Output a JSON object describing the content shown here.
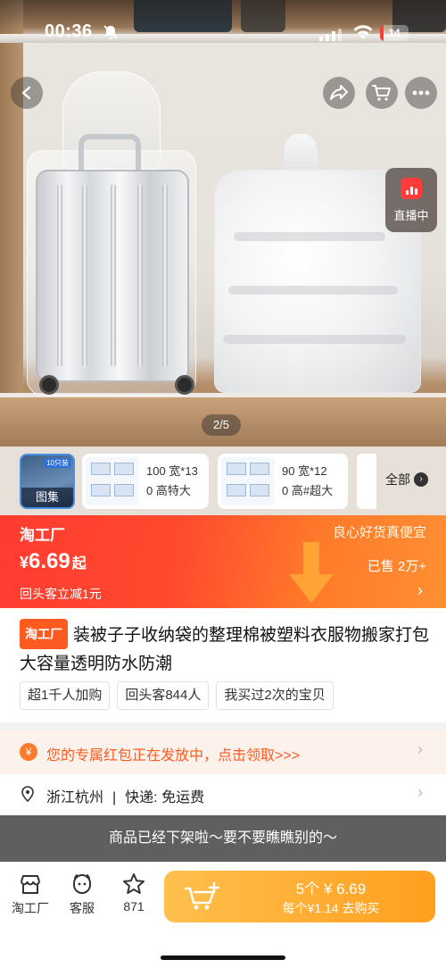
{
  "status_bar": {
    "time": "00:36",
    "battery": "14",
    "battery_level": 0.14
  },
  "nav": {
    "back_icon": "chevron-left-icon",
    "share_icon": "share-icon",
    "cart_icon": "cart-icon",
    "more_icon": "more-icon"
  },
  "live": {
    "label": "直播中"
  },
  "gallery": {
    "counter": "2/5"
  },
  "thumbnails": {
    "gallery_label": "图集",
    "gallery_tag": "10只装",
    "variants": [
      {
        "line1": "100 宽*13",
        "line2": "0 高特大"
      },
      {
        "line1": "90 宽*12",
        "line2": "0 高#超大"
      }
    ],
    "all_label": "全部"
  },
  "price_banner": {
    "brand": "淘工厂",
    "slogan": "良心好货真便宜",
    "price_symbol": "¥",
    "price": "6.69",
    "price_suffix": "起",
    "sold": "已售 2万+",
    "coupon": "回头客立减1元"
  },
  "product": {
    "badge": "淘工厂",
    "title": "装被子子收纳袋的整理棉被塑料衣服物搬家打包大容量透明防水防潮",
    "tags": [
      "超1千人加购",
      "回头客844人",
      "我买过2次的宝贝"
    ]
  },
  "redpack": {
    "text": "您的专属红包正在发放中，点击领取>>>"
  },
  "shipping": {
    "location": "浙江杭州",
    "delivery": "快递: 免运费"
  },
  "delisted": {
    "text": "商品已经下架啦～要不要瞧瞧别的～"
  },
  "bottom_bar": {
    "shop_label": "淘工厂",
    "service_label": "客服",
    "fav_count": "871",
    "buy_line1": "5个 ¥ 6.69",
    "buy_line2": "每个¥1.14  去购买"
  },
  "colors": {
    "accent": "#ff3b30",
    "orange": "#ff9f1f",
    "delisted_bg": "#5f5f5f"
  }
}
